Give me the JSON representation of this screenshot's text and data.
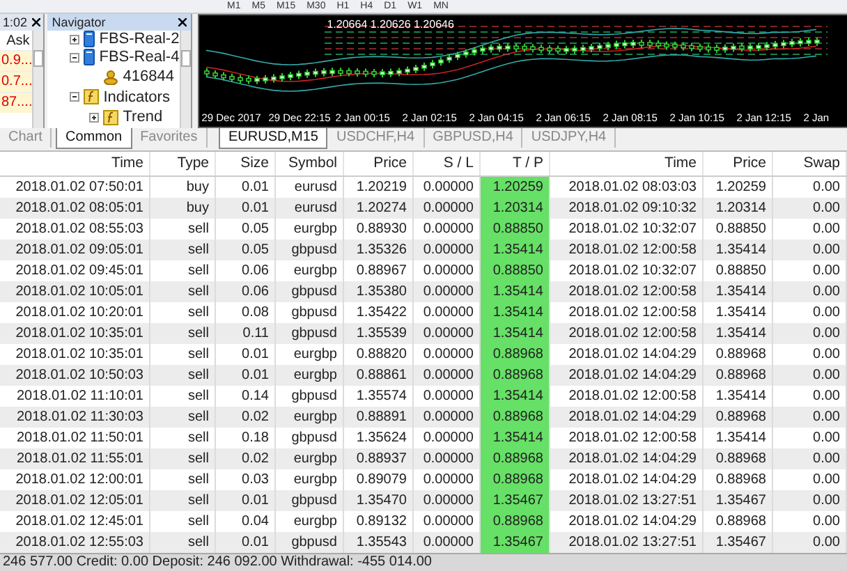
{
  "toolbar": {
    "timeframes": [
      "M1",
      "M5",
      "M15",
      "M30",
      "H1",
      "H4",
      "D1",
      "W1",
      "MN"
    ]
  },
  "market_watch": {
    "time": "1:02",
    "column": "Ask",
    "values": [
      "0.9...",
      "0.7...",
      "87...."
    ],
    "tabs": [
      {
        "label": "Chart",
        "selected": false
      }
    ]
  },
  "navigator": {
    "title": "Navigator",
    "tree": [
      {
        "label": "FBS-Real-2",
        "kind": "server",
        "expanded": false
      },
      {
        "label": "FBS-Real-4",
        "kind": "server",
        "expanded": true,
        "children": [
          {
            "label": "416844",
            "kind": "account"
          }
        ]
      },
      {
        "label": "Indicators",
        "kind": "folder",
        "expanded": true,
        "children": [
          {
            "label": "Trend",
            "kind": "folder",
            "expanded": false
          }
        ]
      }
    ],
    "tabs": [
      {
        "label": "Common",
        "selected": true
      },
      {
        "label": "Favorites",
        "selected": false
      }
    ]
  },
  "chart": {
    "prices": "1.20664 1.20626 1.20646",
    "time_labels": [
      "29 Dec 2017",
      "29 Dec 22:15",
      "2 Jan 00:15",
      "2 Jan 02:15",
      "2 Jan 04:15",
      "2 Jan 06:15",
      "2 Jan 08:15",
      "2 Jan 10:15",
      "2 Jan 12:15",
      "2 Jan"
    ]
  },
  "chart_tabs": [
    {
      "label": "EURUSD,M15",
      "selected": true
    },
    {
      "label": "USDCHF,H4",
      "selected": false
    },
    {
      "label": "GBPUSD,H4",
      "selected": false
    },
    {
      "label": "USDJPY,H4",
      "selected": false
    }
  ],
  "table": {
    "columns": [
      {
        "label": "Time",
        "highlight": false
      },
      {
        "label": "Type",
        "highlight": false
      },
      {
        "label": "Size",
        "highlight": false
      },
      {
        "label": "Symbol",
        "highlight": false
      },
      {
        "label": "Price",
        "highlight": false
      },
      {
        "label": "S / L",
        "highlight": false
      },
      {
        "label": "T / P",
        "highlight": true
      },
      {
        "label": "Time",
        "highlight": false
      },
      {
        "label": "Price",
        "highlight": false
      },
      {
        "label": "Swap",
        "highlight": false
      }
    ],
    "rows": [
      [
        "2018.01.02 07:50:01",
        "buy",
        "0.01",
        "eurusd",
        "1.20219",
        "0.00000",
        "1.20259",
        "2018.01.02 08:03:03",
        "1.20259",
        "0.00"
      ],
      [
        "2018.01.02 08:05:01",
        "buy",
        "0.01",
        "eurusd",
        "1.20274",
        "0.00000",
        "1.20314",
        "2018.01.02 09:10:32",
        "1.20314",
        "0.00"
      ],
      [
        "2018.01.02 08:55:03",
        "sell",
        "0.05",
        "eurgbp",
        "0.88930",
        "0.00000",
        "0.88850",
        "2018.01.02 10:32:07",
        "0.88850",
        "0.00"
      ],
      [
        "2018.01.02 09:05:01",
        "sell",
        "0.05",
        "gbpusd",
        "1.35326",
        "0.00000",
        "1.35414",
        "2018.01.02 12:00:58",
        "1.35414",
        "0.00"
      ],
      [
        "2018.01.02 09:45:01",
        "sell",
        "0.06",
        "eurgbp",
        "0.88967",
        "0.00000",
        "0.88850",
        "2018.01.02 10:32:07",
        "0.88850",
        "0.00"
      ],
      [
        "2018.01.02 10:05:01",
        "sell",
        "0.06",
        "gbpusd",
        "1.35380",
        "0.00000",
        "1.35414",
        "2018.01.02 12:00:58",
        "1.35414",
        "0.00"
      ],
      [
        "2018.01.02 10:20:01",
        "sell",
        "0.08",
        "gbpusd",
        "1.35422",
        "0.00000",
        "1.35414",
        "2018.01.02 12:00:58",
        "1.35414",
        "0.00"
      ],
      [
        "2018.01.02 10:35:01",
        "sell",
        "0.11",
        "gbpusd",
        "1.35539",
        "0.00000",
        "1.35414",
        "2018.01.02 12:00:58",
        "1.35414",
        "0.00"
      ],
      [
        "2018.01.02 10:35:01",
        "sell",
        "0.01",
        "eurgbp",
        "0.88820",
        "0.00000",
        "0.88968",
        "2018.01.02 14:04:29",
        "0.88968",
        "0.00"
      ],
      [
        "2018.01.02 10:50:03",
        "sell",
        "0.01",
        "eurgbp",
        "0.88861",
        "0.00000",
        "0.88968",
        "2018.01.02 14:04:29",
        "0.88968",
        "0.00"
      ],
      [
        "2018.01.02 11:10:01",
        "sell",
        "0.14",
        "gbpusd",
        "1.35574",
        "0.00000",
        "1.35414",
        "2018.01.02 12:00:58",
        "1.35414",
        "0.00"
      ],
      [
        "2018.01.02 11:30:03",
        "sell",
        "0.02",
        "eurgbp",
        "0.88891",
        "0.00000",
        "0.88968",
        "2018.01.02 14:04:29",
        "0.88968",
        "0.00"
      ],
      [
        "2018.01.02 11:50:01",
        "sell",
        "0.18",
        "gbpusd",
        "1.35624",
        "0.00000",
        "1.35414",
        "2018.01.02 12:00:58",
        "1.35414",
        "0.00"
      ],
      [
        "2018.01.02 11:55:01",
        "sell",
        "0.02",
        "eurgbp",
        "0.88937",
        "0.00000",
        "0.88968",
        "2018.01.02 14:04:29",
        "0.88968",
        "0.00"
      ],
      [
        "2018.01.02 12:00:01",
        "sell",
        "0.03",
        "eurgbp",
        "0.89079",
        "0.00000",
        "0.88968",
        "2018.01.02 14:04:29",
        "0.88968",
        "0.00"
      ],
      [
        "2018.01.02 12:05:01",
        "sell",
        "0.01",
        "gbpusd",
        "1.35470",
        "0.00000",
        "1.35467",
        "2018.01.02 13:27:51",
        "1.35467",
        "0.00"
      ],
      [
        "2018.01.02 12:45:01",
        "sell",
        "0.04",
        "eurgbp",
        "0.89132",
        "0.00000",
        "0.88968",
        "2018.01.02 14:04:29",
        "0.88968",
        "0.00"
      ],
      [
        "2018.01.02 12:55:03",
        "sell",
        "0.01",
        "gbpusd",
        "1.35543",
        "0.00000",
        "1.35467",
        "2018.01.02 13:27:51",
        "1.35467",
        "0.00"
      ]
    ]
  },
  "status_bar": {
    "text": "246 577.00  Credit: 0.00  Deposit: 246 092.00  Withdrawal: -455 014.00"
  }
}
